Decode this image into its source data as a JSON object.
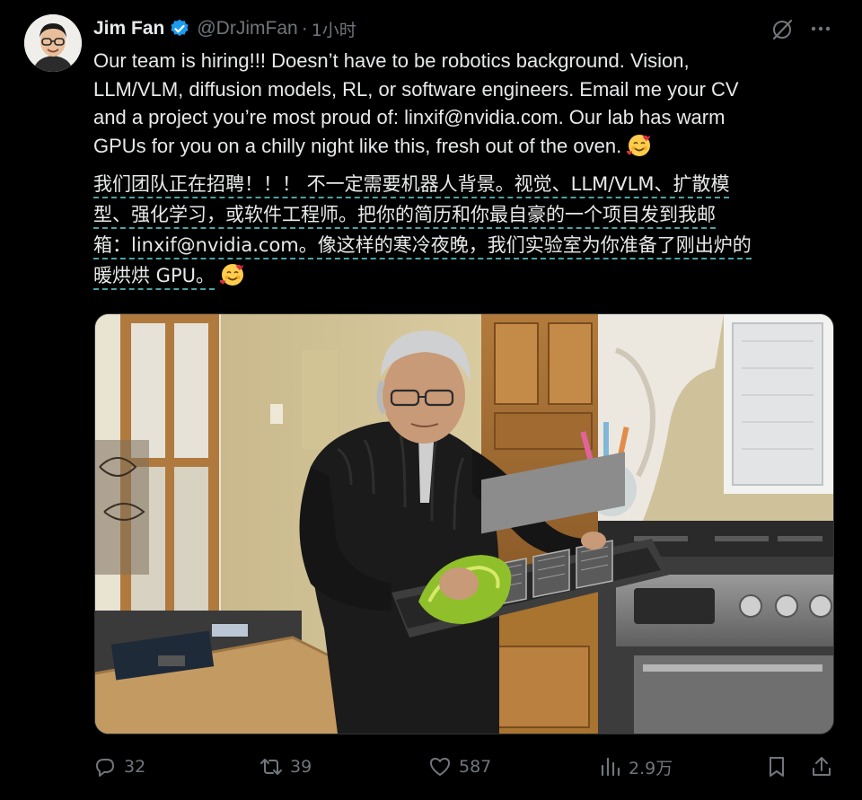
{
  "tweet": {
    "author_name": "Jim Fan",
    "handle": "@DrJimFan",
    "separator": "·",
    "time": "1小时",
    "text_en": "Our team is hiring!!! Doesn’t have to be robotics background. Vision,\nLLM/VLM, diffusion models, RL, or software engineers. Email me your CV\nand a project you’re most proud of: linxif@nvidia.com. Our lab has warm\nGPUs for you on a chilly night like this, fresh out of the oven.",
    "text_zh_lines": [
      "我们团队正在招聘！！！ 不一定需要机器人背景。视觉、LLM/VLM、扩散模",
      "型、强化学习，或软件工程师。把你的简历和你最自豪的一个项目发到我邮",
      "箱：linxif@nvidia.com。像这样的寒冷夜晚，我们实验室为你准备了刚出炉的",
      "暖烘烘 GPU。"
    ],
    "emoji": "smiling-face-with-hearts"
  },
  "actions": {
    "replies": "32",
    "retweets": "39",
    "likes": "587",
    "views": "2.9万"
  },
  "colors": {
    "background": "#000000",
    "text": "#e7e9ea",
    "muted": "#71767b",
    "verified": "#1d9bf0",
    "translation_underline": "#4aa3a3"
  }
}
